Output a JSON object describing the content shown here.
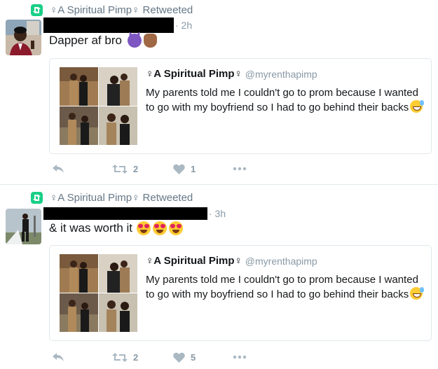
{
  "tweets": [
    {
      "retweet_label": "♀A Spiritual Pimp♀ Retweeted",
      "time": "· 2h",
      "text": "Dapper af bro",
      "emojis": [
        "smiling-devil",
        "raised-fist"
      ],
      "quote": {
        "name": "♀A Spiritual Pimp♀",
        "handle": "@myrenthapimp",
        "text": "My parents told me I couldn't go to prom because I wanted to go with my boyfriend so I had to go behind their backs"
      },
      "actions": {
        "retweet_count": "2",
        "like_count": "1"
      }
    },
    {
      "retweet_label": "♀A Spiritual Pimp♀ Retweeted",
      "time": "· 3h",
      "text": "& it was worth it",
      "emojis": [
        "heart-eyes",
        "heart-eyes",
        "heart-eyes"
      ],
      "quote": {
        "name": "♀A Spiritual Pimp♀",
        "handle": "@myrenthapimp",
        "text": "My parents told me I couldn't go to prom because I wanted to go with my boyfriend so I had to go behind their backs"
      },
      "actions": {
        "retweet_count": "2",
        "like_count": "5"
      }
    }
  ],
  "colors": {
    "retweet_green": "#19cf86",
    "meta_gray": "#8899a6",
    "text": "#14171a",
    "border": "#e1e8ed",
    "action_icon": "#aab8c2"
  }
}
